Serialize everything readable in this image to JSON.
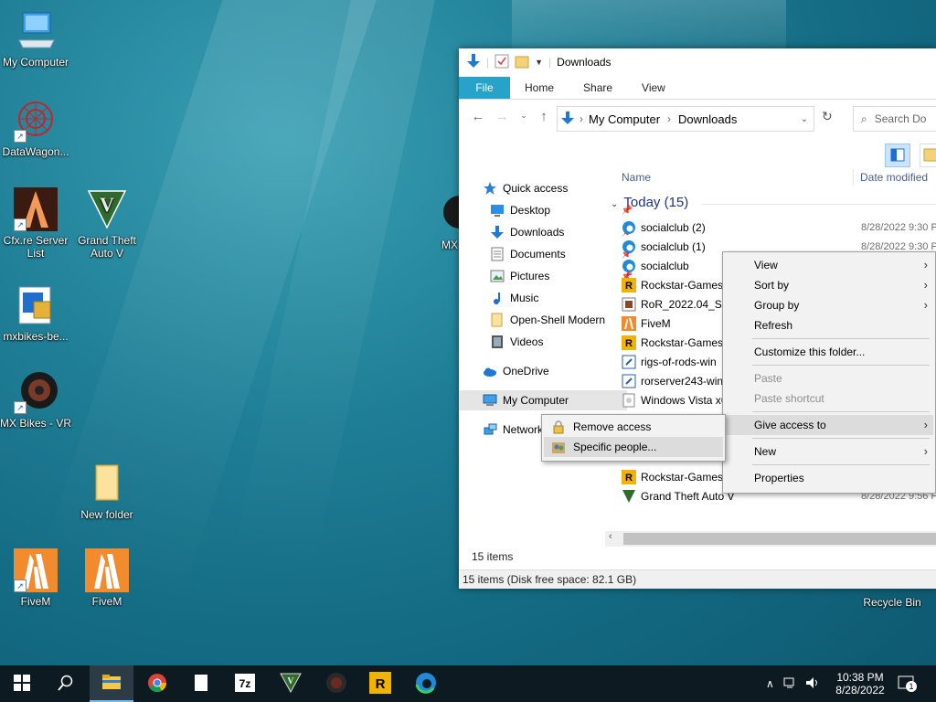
{
  "desktop": {
    "icons": [
      {
        "label": "My Computer"
      },
      {
        "label": "DataWagon..."
      },
      {
        "label": "Cfx.re Server List"
      },
      {
        "label": "Grand Theft Auto V"
      },
      {
        "label": "mxbikes-be..."
      },
      {
        "label": "MX Bikes - VR"
      },
      {
        "label": "New folder"
      },
      {
        "label": "FiveM"
      },
      {
        "label": "FiveM"
      },
      {
        "label": "MX"
      },
      {
        "label": "Recycle Bin"
      }
    ]
  },
  "explorer": {
    "title": "Downloads",
    "tabs": [
      "File",
      "Home",
      "Share",
      "View"
    ],
    "breadcrumb": [
      "My Computer",
      "Downloads"
    ],
    "search_placeholder": "Search Do",
    "columns": {
      "name": "Name",
      "date": "Date modified"
    },
    "group_label": "Today (15)",
    "nav": [
      {
        "label": "Quick access",
        "icon": "star-icon"
      },
      {
        "label": "Desktop",
        "icon": "desktop-icon",
        "pinned": true
      },
      {
        "label": "Downloads",
        "icon": "download-arrow-icon",
        "pinned": true
      },
      {
        "label": "Documents",
        "icon": "document-icon",
        "pinned": true
      },
      {
        "label": "Pictures",
        "icon": "picture-icon",
        "pinned": true
      },
      {
        "label": "Music",
        "icon": "music-icon"
      },
      {
        "label": "Open-Shell Modern",
        "icon": "folder-icon"
      },
      {
        "label": "Videos",
        "icon": "video-icon"
      },
      {
        "label": "OneDrive",
        "icon": "cloud-icon"
      },
      {
        "label": "My Computer",
        "icon": "computer-icon"
      },
      {
        "label": "Network",
        "icon": "network-icon"
      }
    ],
    "files": [
      {
        "name": "socialclub (2)",
        "date": "8/28/2022 9:30 P",
        "icon": "edge-icon"
      },
      {
        "name": "socialclub (1)",
        "date": "8/28/2022 9:30 P",
        "icon": "edge-icon"
      },
      {
        "name": "socialclub",
        "date": "",
        "icon": "edge-icon"
      },
      {
        "name": "Rockstar-Games-",
        "date": "",
        "icon": "rockstar-icon"
      },
      {
        "name": "RoR_2022.04_Setu",
        "date": "",
        "icon": "installer-icon"
      },
      {
        "name": "FiveM",
        "date": "",
        "icon": "fivem-icon"
      },
      {
        "name": "Rockstar-Games-",
        "date": "",
        "icon": "rockstar-icon"
      },
      {
        "name": "rigs-of-rods-win",
        "date": "",
        "icon": "installer-icon"
      },
      {
        "name": "rorserver243-win",
        "date": "",
        "icon": "installer-icon"
      },
      {
        "name": "Windows Vista x6",
        "date": "",
        "icon": "file-icon"
      },
      {
        "name": "Rockstar-Games-",
        "date": "",
        "icon": "rockstar-icon"
      },
      {
        "name": "Grand Theft Auto V",
        "date": "8/28/2022 9:56 P",
        "icon": "gta-icon"
      }
    ],
    "item_count": "15 items",
    "status": "15 items (Disk free space: 82.1 GB)"
  },
  "context_menu": {
    "items": [
      {
        "label": "View",
        "submenu": true
      },
      {
        "label": "Sort by",
        "submenu": true
      },
      {
        "label": "Group by",
        "submenu": true
      },
      {
        "label": "Refresh"
      },
      {
        "label": "Customize this folder..."
      },
      {
        "label": "Paste",
        "disabled": true
      },
      {
        "label": "Paste shortcut",
        "disabled": true
      },
      {
        "label": "Give access to",
        "submenu": true,
        "highlighted": true
      },
      {
        "label": "New",
        "submenu": true
      },
      {
        "label": "Properties"
      }
    ]
  },
  "submenu": {
    "items": [
      {
        "label": "Remove access",
        "icon": "lock-icon"
      },
      {
        "label": "Specific people...",
        "icon": "people-icon",
        "highlighted": true
      }
    ]
  },
  "taskbar": {
    "time": "10:38 PM",
    "date": "8/28/2022",
    "notifications": "1"
  },
  "colors": {
    "file_tab": "#27a3c9",
    "taskbar": "#0e1a22",
    "accent": "#1979ca"
  }
}
